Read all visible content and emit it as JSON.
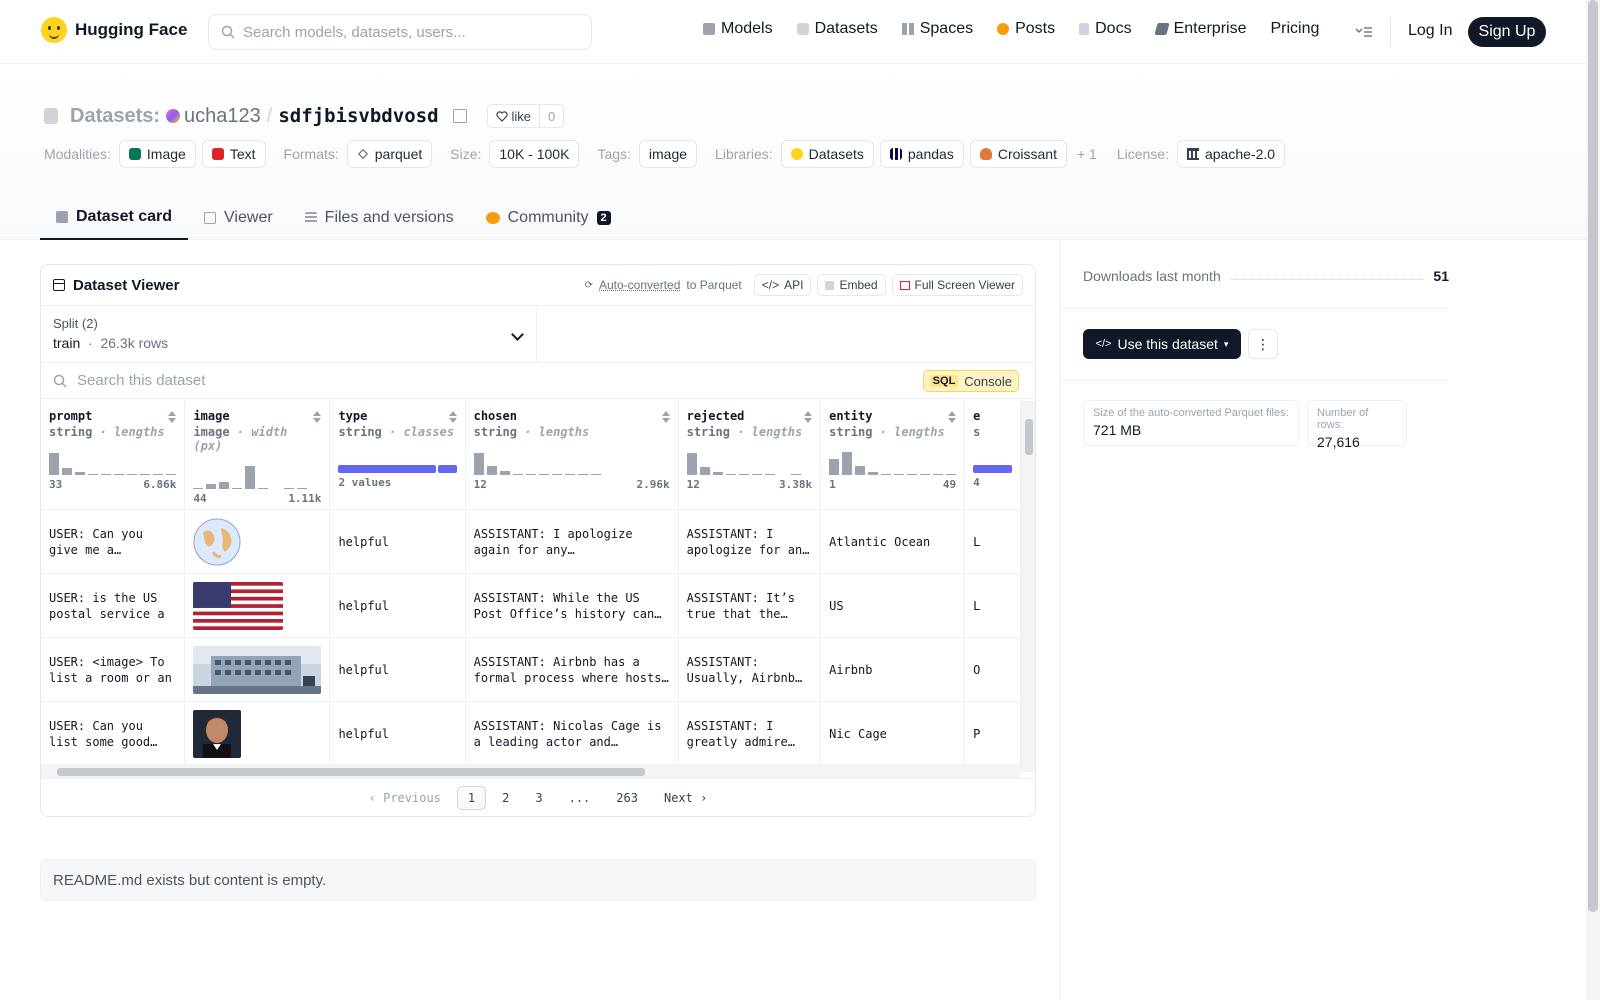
{
  "header": {
    "brand": "Hugging Face",
    "search_placeholder": "Search models, datasets, users...",
    "nav": [
      {
        "label": "Models",
        "icon": "cube-icon",
        "color": "#6b7280"
      },
      {
        "label": "Datasets",
        "icon": "database-icon",
        "color": "#9ca3af"
      },
      {
        "label": "Spaces",
        "icon": "grid-icon",
        "color": "#9ca3af"
      },
      {
        "label": "Posts",
        "icon": "posts-icon",
        "color": "#f59e0b"
      },
      {
        "label": "Docs",
        "icon": "docs-icon",
        "color": "#9ca3af"
      },
      {
        "label": "Enterprise",
        "icon": "enterprise-icon",
        "color": "#6b7280"
      },
      {
        "label": "Pricing",
        "icon": "",
        "color": ""
      }
    ],
    "login": "Log In",
    "signup": "Sign Up"
  },
  "repo": {
    "category": "Datasets:",
    "user": "ucha123",
    "name": "sdfjbisvbdvosd",
    "like_label": "like",
    "like_count": "0"
  },
  "tags": {
    "modalities_label": "Modalities:",
    "modalities": [
      "Image",
      "Text"
    ],
    "formats_label": "Formats:",
    "formats": [
      "parquet"
    ],
    "size_label": "Size:",
    "size": "10K - 100K",
    "tags_label": "Tags:",
    "tags": [
      "image"
    ],
    "libraries_label": "Libraries:",
    "libraries": [
      "Datasets",
      "pandas",
      "Croissant"
    ],
    "more": "+ 1",
    "license_label": "License:",
    "license": "apache-2.0"
  },
  "tabs": [
    {
      "label": "Dataset card",
      "active": true
    },
    {
      "label": "Viewer",
      "active": false
    },
    {
      "label": "Files and versions",
      "active": false
    },
    {
      "label": "Community",
      "active": false,
      "badge": "2"
    }
  ],
  "viewer": {
    "title": "Dataset Viewer",
    "auto_converted": "Auto-converted",
    "to_parquet": "to Parquet",
    "api": "API",
    "embed": "Embed",
    "full_screen": "Full Screen Viewer",
    "split_label": "Split (2)",
    "split_name": "train",
    "split_rows": "26.3k rows",
    "search_placeholder": "Search this dataset",
    "sql_tag": "SQL",
    "sql_label": "Console",
    "columns": [
      {
        "name": "prompt",
        "type": "string",
        "stat": "lengths",
        "min": "33",
        "max": "6.86k",
        "hist": [
          0.85,
          0.25,
          0.1,
          0.05,
          0.05,
          0.05,
          0.05,
          0.05,
          0.05,
          0.05
        ]
      },
      {
        "name": "image",
        "type": "image",
        "stat": "width (px)",
        "min": "44",
        "max": "1.11k",
        "hist": [
          0.05,
          0.2,
          0.25,
          0.05,
          0.9,
          0.05,
          0,
          0.05,
          0.05
        ]
      },
      {
        "name": "type",
        "type": "string",
        "stat": "classes",
        "min": "2 values",
        "max": "",
        "classes": [
          0.84,
          0.16
        ]
      },
      {
        "name": "chosen",
        "type": "string",
        "stat": "lengths",
        "min": "12",
        "max": "2.96k",
        "hist": [
          0.85,
          0.35,
          0.15,
          0.05,
          0.05,
          0.05,
          0.05,
          0.05,
          0.05,
          0.05
        ]
      },
      {
        "name": "rejected",
        "type": "string",
        "stat": "lengths",
        "min": "12",
        "max": "3.38k",
        "hist": [
          0.85,
          0.3,
          0.1,
          0.05,
          0.05,
          0.05,
          0.05,
          0,
          0.05
        ]
      },
      {
        "name": "entity",
        "type": "string",
        "stat": "lengths",
        "min": "1",
        "max": "49",
        "hist": [
          0.6,
          0.9,
          0.35,
          0.1,
          0.05,
          0.05,
          0.05,
          0.05,
          0.05,
          0.05
        ]
      },
      {
        "name": "e",
        "type": "s",
        "stat": "",
        "min": "4",
        "max": "",
        "classes": [
          1.0
        ]
      }
    ],
    "rows": [
      {
        "prompt": "USER: Can you give me a bulleted list of",
        "image": "globe",
        "type": "helpful",
        "chosen": "ASSISTANT: I apologize again for any misunderstanding, but",
        "rejected": "ASSISTANT: I apologize for any misunderstanding",
        "entity": "Atlantic Ocean",
        "e": "L"
      },
      {
        "prompt": "USER: is the US postal service a",
        "image": "flag",
        "type": "helpful",
        "chosen": "ASSISTANT: While the US Post Office’s history can be traced",
        "rejected": "ASSISTANT: It’s true that the Postal",
        "entity": "US",
        "e": "L"
      },
      {
        "prompt": "USER: <image> To list a room or an",
        "image": "building",
        "type": "helpful",
        "chosen": "ASSISTANT: Airbnb has a formal process where hosts create an",
        "rejected": "ASSISTANT: Usually, Airbnb hosts",
        "entity": "Airbnb",
        "e": "O"
      },
      {
        "prompt": "USER: Can you list some good Nicolas",
        "image": "portrait",
        "type": "helpful",
        "chosen": "ASSISTANT: Nicolas Cage is a leading actor and occasionally",
        "rejected": "ASSISTANT: I greatly admire Nicolas",
        "entity": "Nic Cage",
        "e": "P"
      }
    ],
    "pager": {
      "prev": "Previous",
      "pages": [
        "1",
        "2",
        "3",
        "...",
        "263"
      ],
      "next": "Next",
      "current": "1"
    }
  },
  "readme": "README.md exists but content is empty.",
  "sidebar": {
    "downloads_label": "Downloads last month",
    "downloads_value": "51",
    "use_button": "Use this dataset",
    "size_label": "Size of the auto-converted Parquet files:",
    "size_value": "721 MB",
    "rows_label": "Number of rows:",
    "rows_value": "27,616"
  },
  "colors": {
    "brand": "#ffd21e",
    "dark": "#111827",
    "classes_bar": "#6366f1"
  }
}
